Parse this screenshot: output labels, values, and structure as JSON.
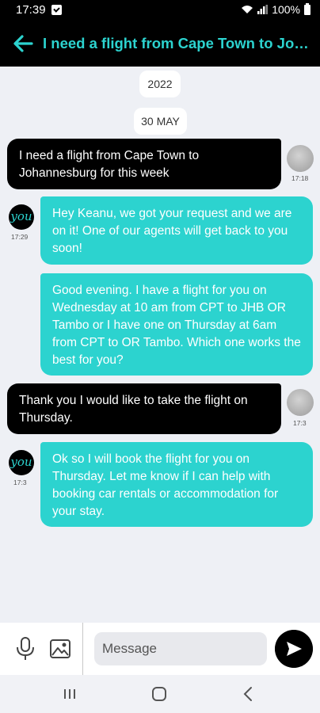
{
  "status_bar": {
    "time": "17:39",
    "battery": "100%"
  },
  "header": {
    "title": "I need a flight from Cape Town to Johannesburg for this week",
    "back_icon": "arrow-left-icon"
  },
  "date_chips": {
    "year": "2022",
    "date": "30 MAY"
  },
  "messages": [
    {
      "sender": "user",
      "text": "I need a flight from Cape Town to Johannesburg for this week",
      "time": "17:18"
    },
    {
      "sender": "agent",
      "text": "Hey Keanu, we got your request and we are on it!  One of our agents will get back to you soon!",
      "time": "17:29"
    },
    {
      "sender": "agent",
      "text": "Good evening. I have a flight for you on Wednesday at 10 am from CPT to JHB OR Tambo or I have one on Thursday at 6am from CPT to OR Tambo.  Which one works the best for you?",
      "time": ""
    },
    {
      "sender": "user",
      "text": "Thank you I would like to take the flight on Thursday.",
      "time": "17:3"
    },
    {
      "sender": "agent",
      "text": "Ok so I will book the flight for you on Thursday. Let me know if I can help with booking car rentals or accommodation for your stay.",
      "time": "17:3"
    }
  ],
  "brand_avatar_text": "you",
  "input": {
    "placeholder": "Message"
  },
  "colors": {
    "accent": "#2cd3cf",
    "header_bg": "#000000",
    "chat_bg": "#eef0f5"
  }
}
